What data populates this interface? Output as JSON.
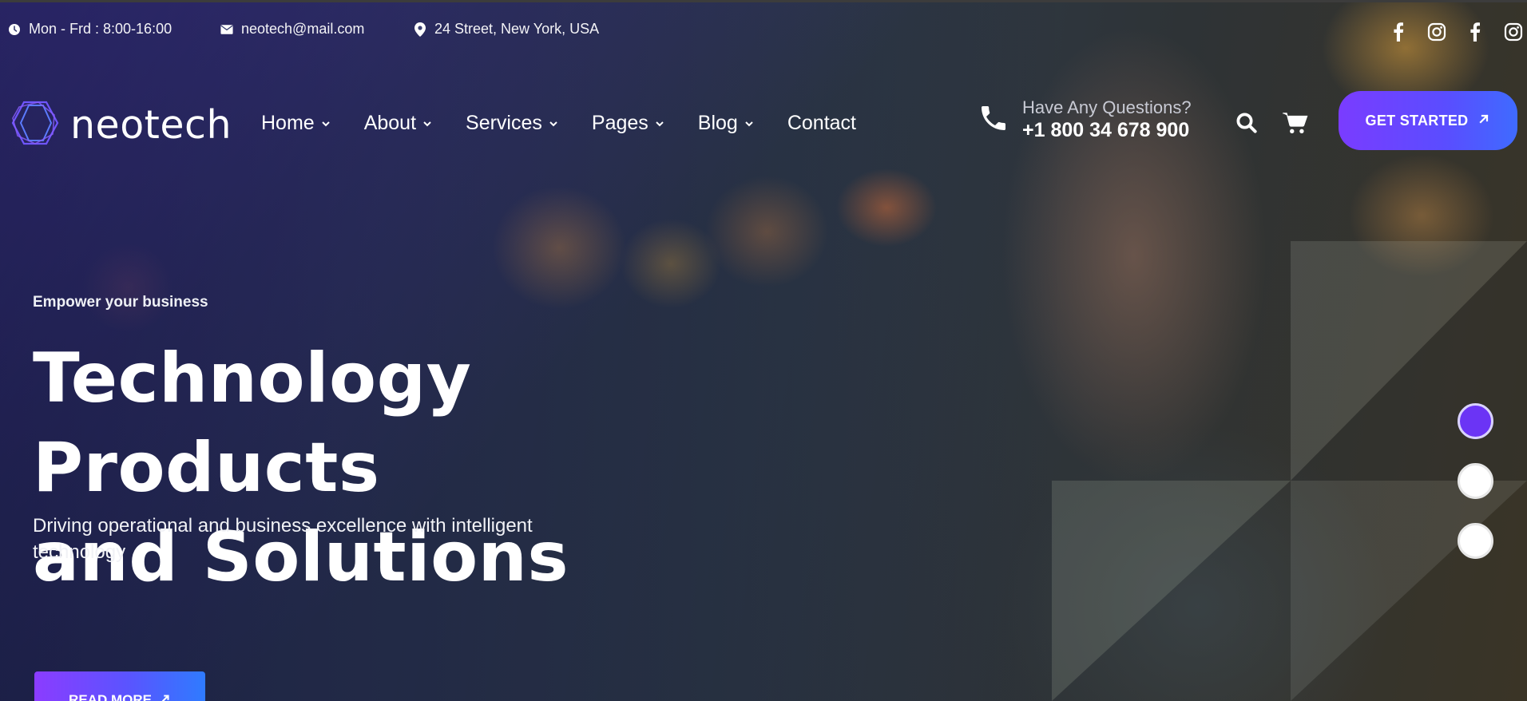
{
  "topbar": {
    "hours": "Mon - Frd : 8:00-16:00",
    "email": "neotech@mail.com",
    "address": "24 Street, New York, USA",
    "hours_icon": "clock-icon",
    "email_icon": "envelope-icon",
    "address_icon": "map-pin-icon",
    "social": [
      "facebook-icon",
      "instagram-icon",
      "facebook-icon",
      "instagram-icon"
    ]
  },
  "nav": {
    "logo_text": "neotech",
    "menu": [
      {
        "label": "Home",
        "has_dropdown": true
      },
      {
        "label": "About",
        "has_dropdown": true
      },
      {
        "label": "Services",
        "has_dropdown": true
      },
      {
        "label": "Pages",
        "has_dropdown": true
      },
      {
        "label": "Blog",
        "has_dropdown": true
      },
      {
        "label": "Contact",
        "has_dropdown": false
      }
    ],
    "phone_question": "Have Any Questions?",
    "phone_number": "+1 800 34 678 900",
    "cta_label": "GET STARTED"
  },
  "hero": {
    "eyebrow": "Empower your business",
    "headline_line1": "Technology Products",
    "headline_line2": "and Solutions",
    "subtext": "Driving operational and business excellence with intelligent technology",
    "button_label": "READ MORE"
  },
  "slider": {
    "count": 3,
    "active_index": 0
  },
  "colors": {
    "accent": "#6b34f5",
    "button_gradient_start": "#7a3cff",
    "button_gradient_end": "#3f6bff"
  }
}
